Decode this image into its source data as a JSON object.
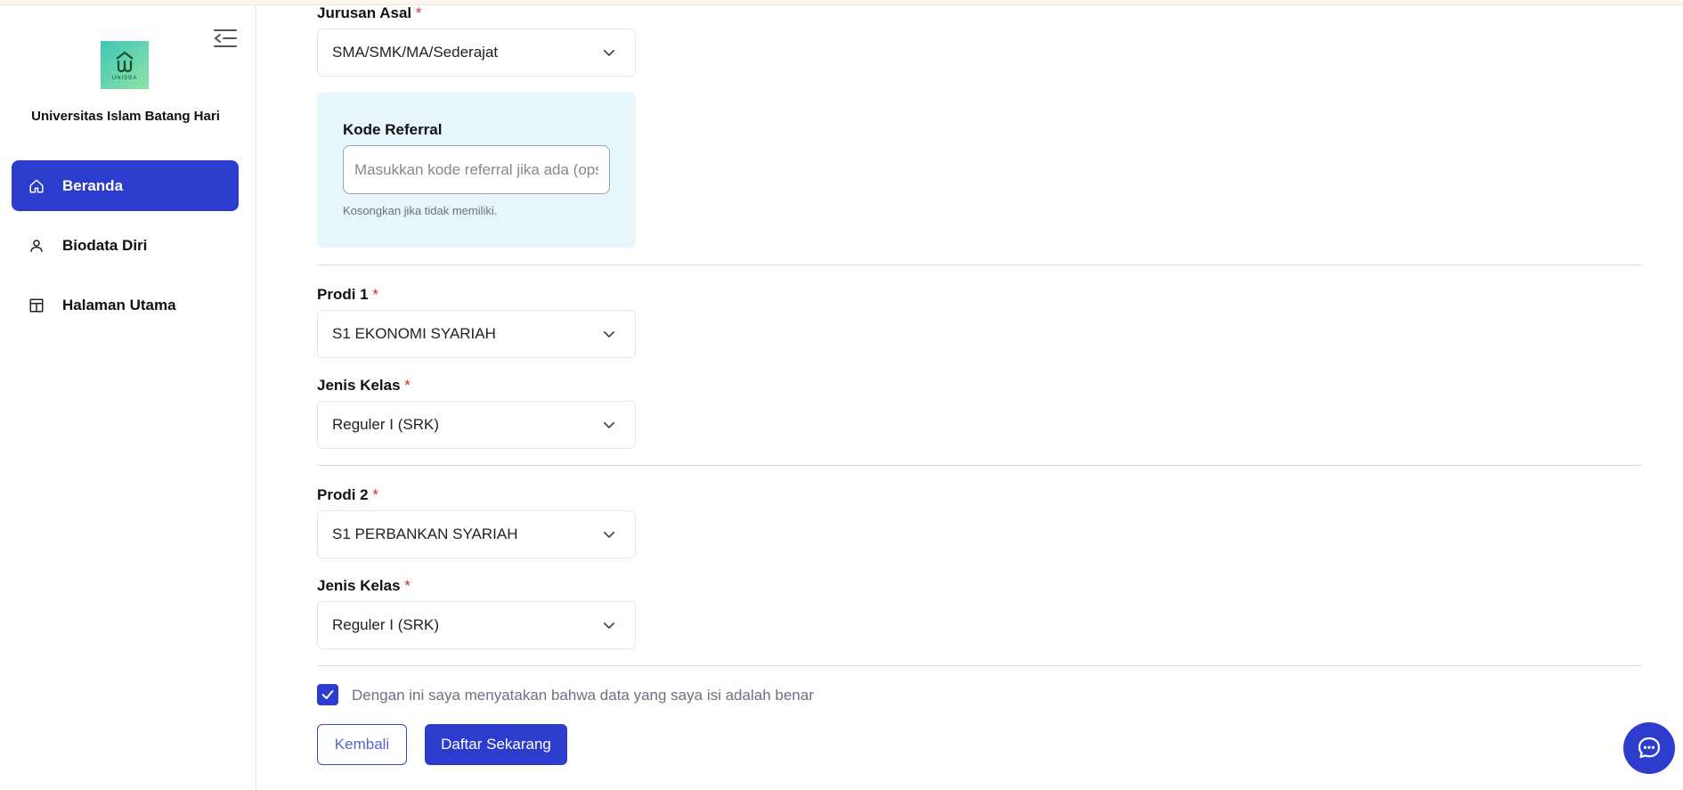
{
  "sidebar": {
    "university_name": "Universitas Islam Batang Hari",
    "logo_text": "UNISBA",
    "items": [
      {
        "label": "Beranda",
        "icon": "home-icon"
      },
      {
        "label": "Biodata Diri",
        "icon": "user-icon"
      },
      {
        "label": "Halaman Utama",
        "icon": "layout-icon"
      }
    ]
  },
  "form": {
    "jurusan_asal": {
      "label": "Jurusan Asal",
      "required": "*",
      "value": "SMA/SMK/MA/Sederajat"
    },
    "referral": {
      "title": "Kode Referral",
      "placeholder": "Masukkan kode referral jika ada (opsional)",
      "hint": "Kosongkan jika tidak memiliki."
    },
    "prodi1": {
      "label": "Prodi 1",
      "required": "*",
      "value": "S1 EKONOMI SYARIAH"
    },
    "kelas1": {
      "label": "Jenis Kelas",
      "required": "*",
      "value": "Reguler I (SRK)"
    },
    "prodi2": {
      "label": "Prodi 2",
      "required": "*",
      "value": "S1 PERBANKAN SYARIAH"
    },
    "kelas2": {
      "label": "Jenis Kelas",
      "required": "*",
      "value": "Reguler I (SRK)"
    },
    "agreement": {
      "text": "Dengan ini saya menyatakan bahwa data yang saya isi adalah benar",
      "checked": true
    },
    "back_label": "Kembali",
    "submit_label": "Daftar Sekarang"
  },
  "colors": {
    "primary": "#2c3ccc",
    "required": "#dc2626",
    "referral_bg": "#e6f6fb"
  }
}
